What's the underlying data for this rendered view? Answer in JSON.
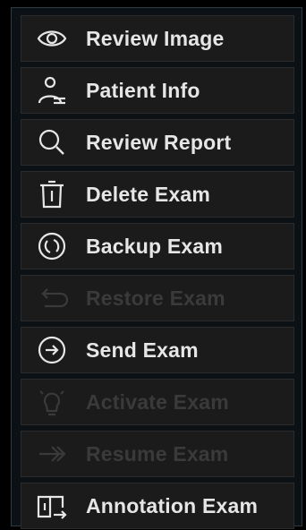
{
  "menu": {
    "items": [
      {
        "label": "Review Image",
        "icon": "eye-icon",
        "enabled": true
      },
      {
        "label": "Patient Info",
        "icon": "person-info-icon",
        "enabled": true
      },
      {
        "label": "Review Report",
        "icon": "search-icon",
        "enabled": true
      },
      {
        "label": "Delete Exam",
        "icon": "trash-icon",
        "enabled": true
      },
      {
        "label": "Backup Exam",
        "icon": "backup-icon",
        "enabled": true
      },
      {
        "label": "Restore Exam",
        "icon": "undo-arrow-icon",
        "enabled": false
      },
      {
        "label": "Send Exam",
        "icon": "send-arrow-icon",
        "enabled": true
      },
      {
        "label": "Activate Exam",
        "icon": "lightbulb-icon",
        "enabled": false
      },
      {
        "label": "Resume Exam",
        "icon": "double-arrow-icon",
        "enabled": false
      },
      {
        "label": "Annotation Exam",
        "icon": "annotation-book-icon",
        "enabled": true
      }
    ]
  },
  "colors": {
    "item_background": "#1b1b1b",
    "text_enabled": "#e6e6e6",
    "text_disabled": "#3a3a3a",
    "panel_background": "#0b1114"
  }
}
